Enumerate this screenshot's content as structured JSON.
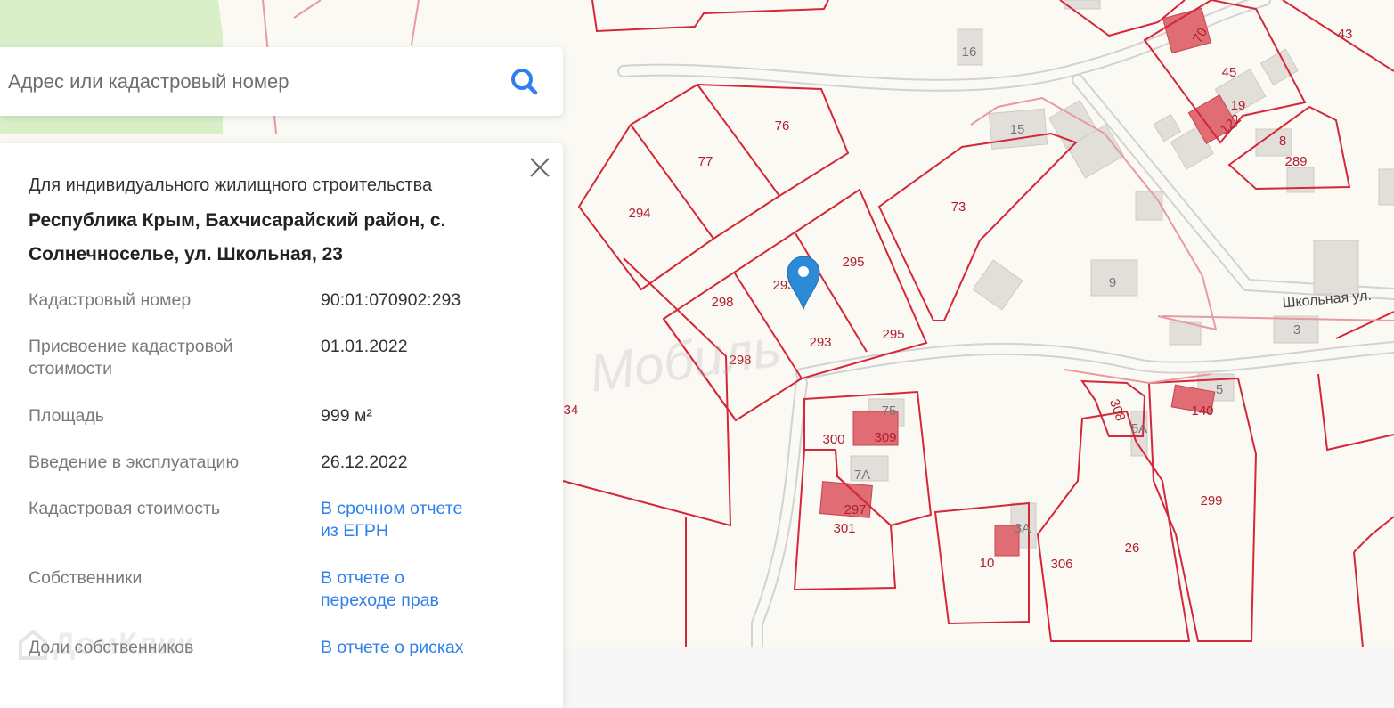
{
  "search": {
    "placeholder": "Адрес или кадастровый номер",
    "icon": "search-icon"
  },
  "card": {
    "purpose": "Для индивидуального жилищного строительства",
    "address": "Республика Крым, Бахчисарайский район, с. Солнечноселье, ул. Школьная, 23",
    "rows": [
      {
        "label": "Кадастровый номер",
        "value": "90:01:070902:293"
      },
      {
        "label": "Присвоение кадастровой стоимости",
        "value": "01.01.2022"
      },
      {
        "label": "Площадь",
        "value": "999 м²"
      },
      {
        "label": "Введение в эксплуатацию",
        "value": "26.12.2022"
      },
      {
        "label": "Кадастровая стоимость",
        "value": "В срочном отчете из ЕГРН"
      },
      {
        "label": "Собственники",
        "value": "В отчете о переходе прав"
      },
      {
        "label": "Доли собственников",
        "value": "В отчете о рисках"
      }
    ],
    "watermark": "ДомКлик"
  },
  "map": {
    "street_label": "Школьная ул.",
    "watermark": "Мобиль",
    "parcel_labels": [
      "76",
      "77",
      "294",
      "295",
      "298",
      "293",
      "298",
      "295",
      "293",
      "73",
      "43",
      "45",
      "19",
      "122",
      "70",
      "8",
      "289",
      "15",
      "16",
      "9",
      "3",
      "5",
      "140",
      "5А",
      "308",
      "75",
      "309",
      "300",
      "7А",
      "297",
      "301",
      "3А",
      "10",
      "306",
      "26",
      "299",
      "34"
    ],
    "colors": {
      "parcel_line": "#d4273a",
      "building": "#e2dfda",
      "building_owned": "#e06c74",
      "marker": "#2d8ad6"
    }
  }
}
